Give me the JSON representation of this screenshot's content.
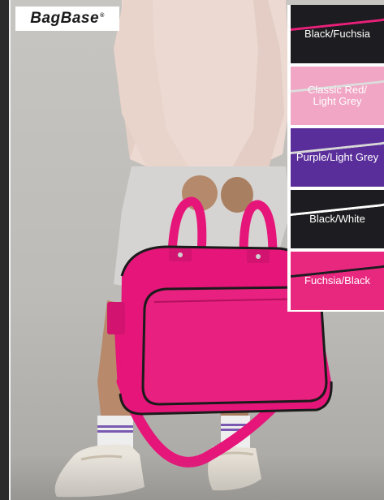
{
  "brand": {
    "logo_text": "BagBase",
    "logo_mark": "®"
  },
  "swatches": [
    {
      "label": "Black/Fuchsia",
      "body_color": "#1d1c20",
      "piping_color": "#e8207a",
      "text_color": "#ffffff"
    },
    {
      "label": "Classic Red/\nLight Grey",
      "body_color": "#f0a6c4",
      "piping_color": "#dcdcdc",
      "text_color": "#ffffff"
    },
    {
      "label": "Purple/Light Grey",
      "body_color": "#5a2e9a",
      "piping_color": "#d7d7d7",
      "text_color": "#ffffff"
    },
    {
      "label": "Black/White",
      "body_color": "#1d1c20",
      "piping_color": "#ffffff",
      "text_color": "#ffffff"
    },
    {
      "label": "Fuchsia/Black",
      "body_color": "#e8287f",
      "piping_color": "#1d1c20",
      "text_color": "#ffffff"
    }
  ],
  "colors": {
    "bag_primary": "#e6157a",
    "bag_trim": "#1b1b1b",
    "sweater": "#ecd9d1",
    "shorts": "#d6d4d2",
    "skin": "#b58a6c"
  }
}
